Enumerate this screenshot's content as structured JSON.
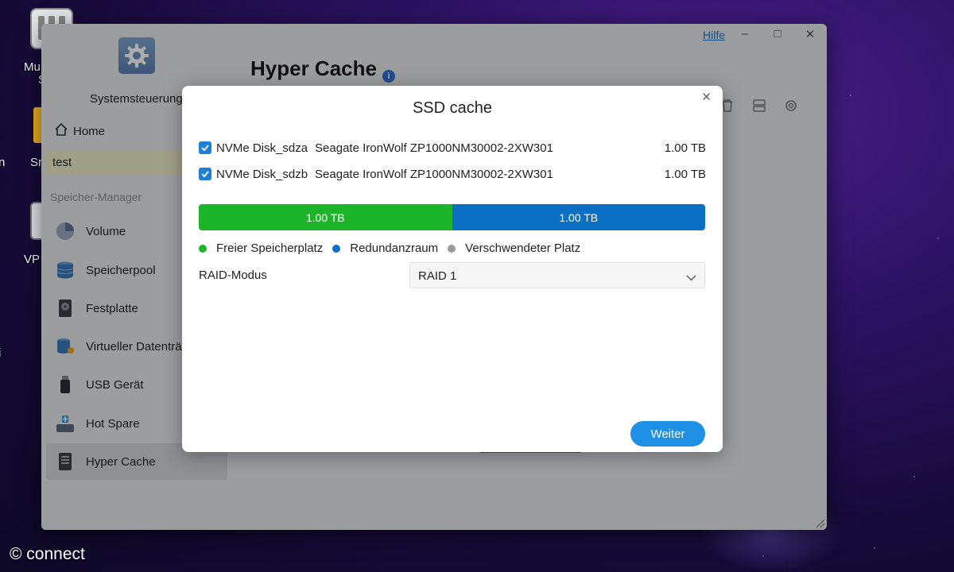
{
  "desktop": {
    "icons": [
      {
        "label": "Mu",
        "label2": "S",
        "icon": "multimedia-icon"
      },
      {
        "label": "Sr",
        "icon": "folder-icon"
      },
      {
        "label": "VP",
        "icon": "vpn-icon"
      }
    ],
    "edge_labels": [
      "n",
      "i"
    ]
  },
  "window": {
    "help_label": "Hilfe",
    "controls": [
      "minimize-icon",
      "maximize-icon",
      "close-icon"
    ]
  },
  "sidebar": {
    "app_title": "Systemsteuerung",
    "home_label": "Home",
    "test_label": "test",
    "section_label": "Speicher-Manager",
    "items": [
      {
        "label": "Volume",
        "icon": "volume-icon"
      },
      {
        "label": "Speicherpool",
        "icon": "storage-pool-icon"
      },
      {
        "label": "Festplatte",
        "icon": "hard-disk-icon"
      },
      {
        "label": "Virtueller Datenträger",
        "icon": "virtual-disk-icon"
      },
      {
        "label": "USB Gerät",
        "icon": "usb-icon"
      },
      {
        "label": "Hot Spare",
        "icon": "hot-spare-icon"
      },
      {
        "label": "Hyper Cache",
        "icon": "hyper-cache-icon"
      }
    ],
    "active_index": 6
  },
  "main": {
    "title": "Hyper Cache",
    "toolbar_icons": [
      "trash-icon",
      "server-icon",
      "settings-icon"
    ]
  },
  "modal": {
    "title": "SSD cache",
    "disks": [
      {
        "checked": true,
        "name": "NVMe Disk_sdza",
        "model": "Seagate IronWolf ZP1000NM30002-2XW301",
        "size": "1.00 TB"
      },
      {
        "checked": true,
        "name": "NVMe Disk_sdzb",
        "model": "Seagate IronWolf ZP1000NM30002-2XW301",
        "size": "1.00 TB"
      }
    ],
    "capacity_bar": [
      {
        "label": "1.00 TB",
        "fraction": 0.5,
        "color": "#1cb52a"
      },
      {
        "label": "1.00 TB",
        "fraction": 0.5,
        "color": "#0b6fc4"
      }
    ],
    "legend": [
      {
        "label": "Freier Speicherplatz",
        "color": "#1cb52a"
      },
      {
        "label": "Redundanzraum",
        "color": "#0b6fc4"
      },
      {
        "label": "Verschwendeter Platz",
        "color": "#9a9a9a"
      }
    ],
    "raid_label": "RAID-Modus",
    "raid_value": "RAID 1",
    "next_button": "Weiter"
  },
  "watermark": "© connect",
  "colors": {
    "accent": "#1e90e6",
    "highlight": "#ecebc8"
  }
}
